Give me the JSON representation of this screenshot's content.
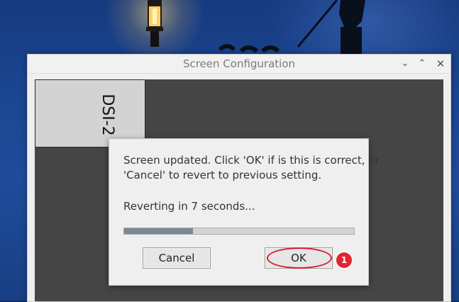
{
  "window": {
    "title": "Screen Configuration",
    "controls": {
      "minimize_icon": "chevron-down-icon",
      "maximize_icon": "chevron-up-icon",
      "close_icon": "close-icon"
    }
  },
  "display_layout": {
    "monitors": [
      {
        "label": "DSI-2"
      }
    ]
  },
  "dialog": {
    "message_line1": "Screen updated. Click 'OK' if is this is correct, or",
    "message_line2": "'Cancel' to revert to previous setting.",
    "revert_text": "Reverting in 7 seconds...",
    "progress_percent": 30,
    "cancel_label": "Cancel",
    "ok_label": "OK"
  },
  "annotation": {
    "step_number": "1",
    "highlight_color": "#d8202a"
  }
}
